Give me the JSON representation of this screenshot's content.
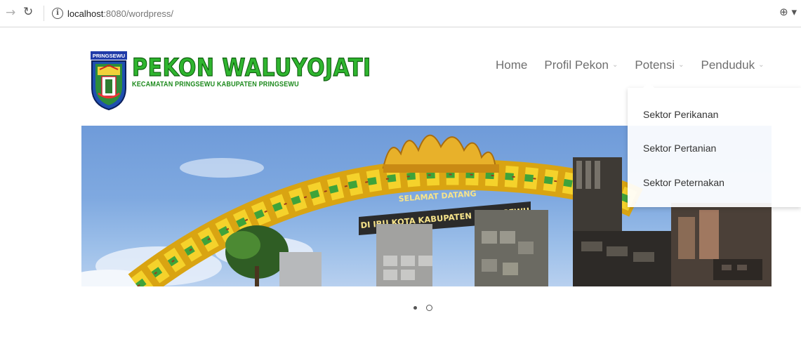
{
  "browser": {
    "url_host": "localhost",
    "url_path": ":8080/wordpress/",
    "icons": {
      "forward": "arrow-right-icon",
      "reload": "reload-icon",
      "info": "info-icon",
      "zoom": "zoom-icon"
    }
  },
  "site": {
    "emblem_label": "PRINGSEWU",
    "title": "PEKON WALUYOJATI",
    "subtitle": "KECAMATAN PRINGSEWU KABUPATEN PRINGSEWU",
    "title_color": "#2fb52f"
  },
  "nav": {
    "items": [
      {
        "label": "Home",
        "has_caret": false
      },
      {
        "label": "Profil Pekon",
        "has_caret": true
      },
      {
        "label": "Potensi",
        "has_caret": true
      },
      {
        "label": "Penduduk",
        "has_caret": true
      }
    ],
    "caret_glyph": "⌄"
  },
  "dropdown": {
    "items": [
      {
        "label": "Sektor Perikanan"
      },
      {
        "label": "Sektor Pertanian"
      },
      {
        "label": "Sektor Peternakan"
      }
    ]
  },
  "slider": {
    "gate_text_line1": "SELAMAT DATANG",
    "gate_text_line2": "DI IBU KOTA KABUPATEN PRINGSEWU",
    "slide_count": 2,
    "active_slide": 1
  }
}
